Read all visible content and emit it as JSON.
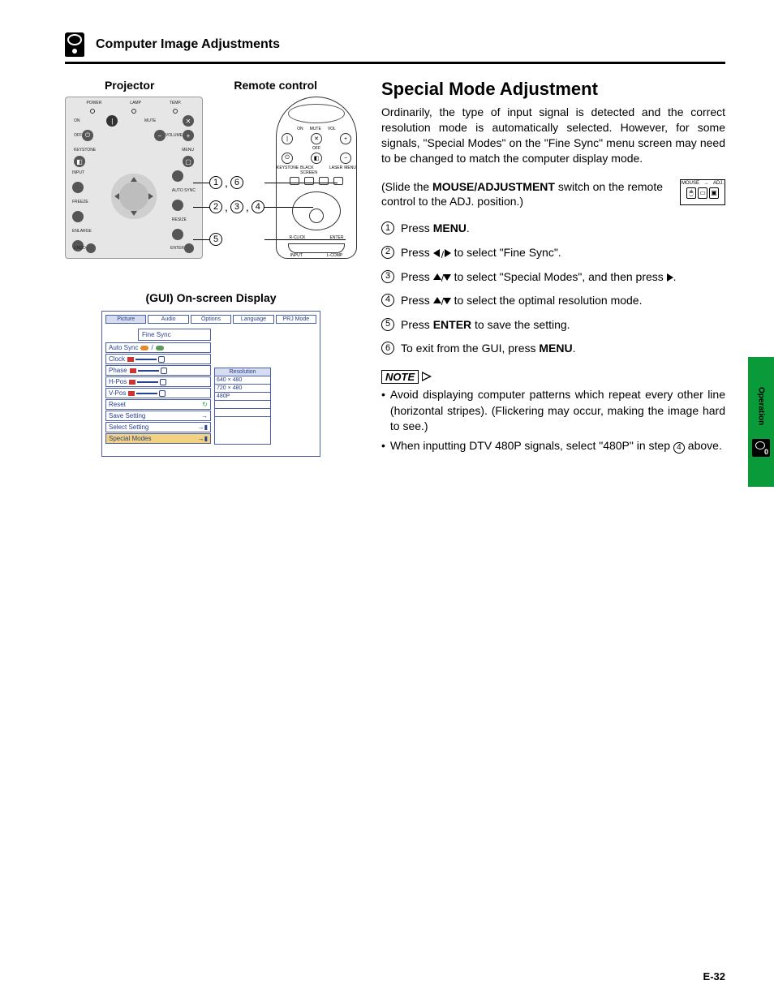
{
  "header": {
    "title": "Computer Image Adjustments"
  },
  "diagram": {
    "projector_label": "Projector",
    "remote_label": "Remote control",
    "projector": {
      "power": "POWER",
      "lamp": "LAMP",
      "temp": "TEMP.",
      "on": "ON",
      "mute": "MUTE",
      "off": "OFF",
      "volume": "VOLUME",
      "keystone": "KEYSTONE",
      "menu": "MENU",
      "input": "INPUT",
      "freeze": "FREEZE",
      "autosync": "AUTO SYNC",
      "enlarge": "ENLARGE",
      "resize": "RESIZE",
      "undo": "UNDO",
      "gamma": "GAMMA",
      "enter": "ENTER"
    },
    "remote": {
      "on": "ON",
      "off": "OFF",
      "mute": "MUTE",
      "vol": "VOL",
      "black_screen": "BLACK SCREEN",
      "laser": "LASER",
      "keystone": "KEYSTONE",
      "menu": "MENU",
      "rclick": "R-CLICK",
      "enter": "ENTER",
      "input": "INPUT",
      "lcomp": "L-COMP",
      "mouse": "MOUSE",
      "adj": "ADJ."
    },
    "callouts": {
      "r1": [
        "1",
        "6"
      ],
      "r2": [
        "2",
        "3",
        "4"
      ],
      "r3": [
        "5"
      ]
    }
  },
  "gui": {
    "title": "(GUI) On-screen Display",
    "tabs": [
      "Picture",
      "Audio",
      "Options",
      "Language",
      "PRJ Mode"
    ],
    "fine_sync": "Fine Sync",
    "items": {
      "auto_sync": "Auto Sync",
      "clock": "Clock",
      "phase": "Phase",
      "hpos": "H-Pos",
      "vpos": "V-Pos",
      "reset": "Reset",
      "save_setting": "Save Setting",
      "select_setting": "Select Setting",
      "special_modes": "Special Modes"
    },
    "resolution": {
      "head": "Resolution",
      "opts": [
        "640 × 480",
        "720 × 480",
        "480P"
      ]
    }
  },
  "main": {
    "heading": "Special Mode Adjustment",
    "intro": "Ordinarily, the type of input signal is detected and the correct resolution mode is automatically selected. However, for some signals, \"Special Modes\" on the \"Fine Sync\" menu screen may need to be changed to match the computer display mode.",
    "slide_pre": "(Slide the ",
    "slide_bold": "MOUSE/ADJUSTMENT",
    "slide_post": " switch on the remote control to the ADJ. position.)",
    "switch": {
      "mouse": "MOUSE",
      "adj": "ADJ."
    },
    "steps": [
      {
        "n": "1",
        "pre": "Press ",
        "bold": "MENU",
        "post": "."
      },
      {
        "n": "2",
        "pre": "Press ",
        "icon": "lr",
        "post": " to select \"Fine Sync\"."
      },
      {
        "n": "3",
        "pre": "Press ",
        "icon": "ud",
        "mid": " to select \"Special Modes\", and then press ",
        "icon2": "r",
        "post": "."
      },
      {
        "n": "4",
        "pre": "Press ",
        "icon": "ud",
        "post": " to select the optimal resolution mode."
      },
      {
        "n": "5",
        "pre": "Press ",
        "bold": "ENTER",
        "post": " to save the setting."
      },
      {
        "n": "6",
        "pre": "To exit from the GUI, press ",
        "bold": "MENU",
        "post": "."
      }
    ],
    "note_label": "NOTE",
    "notes": [
      "Avoid displaying computer patterns which repeat every other line (horizontal stripes). (Flickering may occur, making the image hard to see.)",
      "When inputting DTV 480P signals, select \"480P\" in step 4 above."
    ],
    "note2_step_ref": "4"
  },
  "side_tab": "Operation",
  "page_number": "E-32"
}
